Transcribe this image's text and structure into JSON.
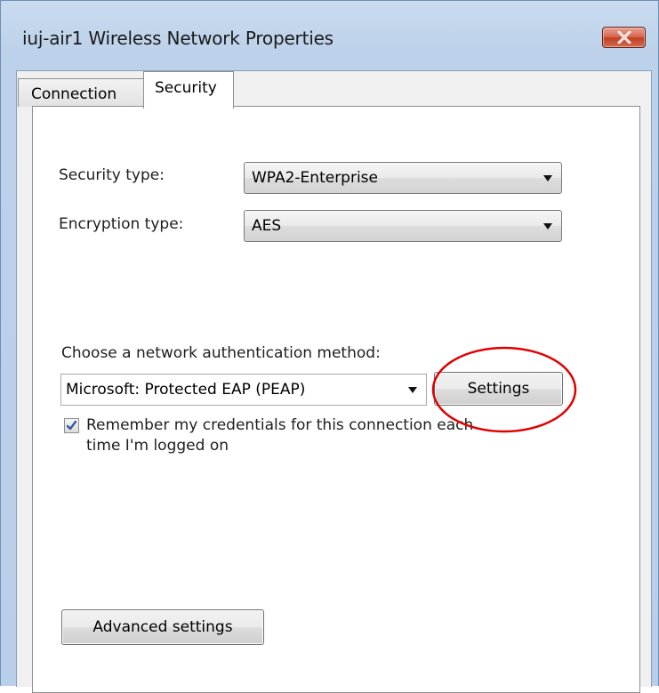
{
  "window": {
    "title": "iuj-air1 Wireless Network Properties"
  },
  "tabs": [
    {
      "label": "Connection",
      "selected": false
    },
    {
      "label": "Security",
      "selected": true
    }
  ],
  "security": {
    "security_type_label": "Security type:",
    "security_type_value": "WPA2-Enterprise",
    "encryption_type_label": "Encryption type:",
    "encryption_type_value": "AES",
    "auth_method_label": "Choose a network authentication method:",
    "auth_method_value": "Microsoft: Protected EAP (PEAP)",
    "settings_button": "Settings",
    "remember_credentials_line1": "Remember my credentials for this connection each",
    "remember_credentials_line2": "time I'm logged on",
    "remember_credentials_checked": true,
    "advanced_settings_button": "Advanced settings"
  },
  "annotation": {
    "highlight_color": "#e00000"
  }
}
